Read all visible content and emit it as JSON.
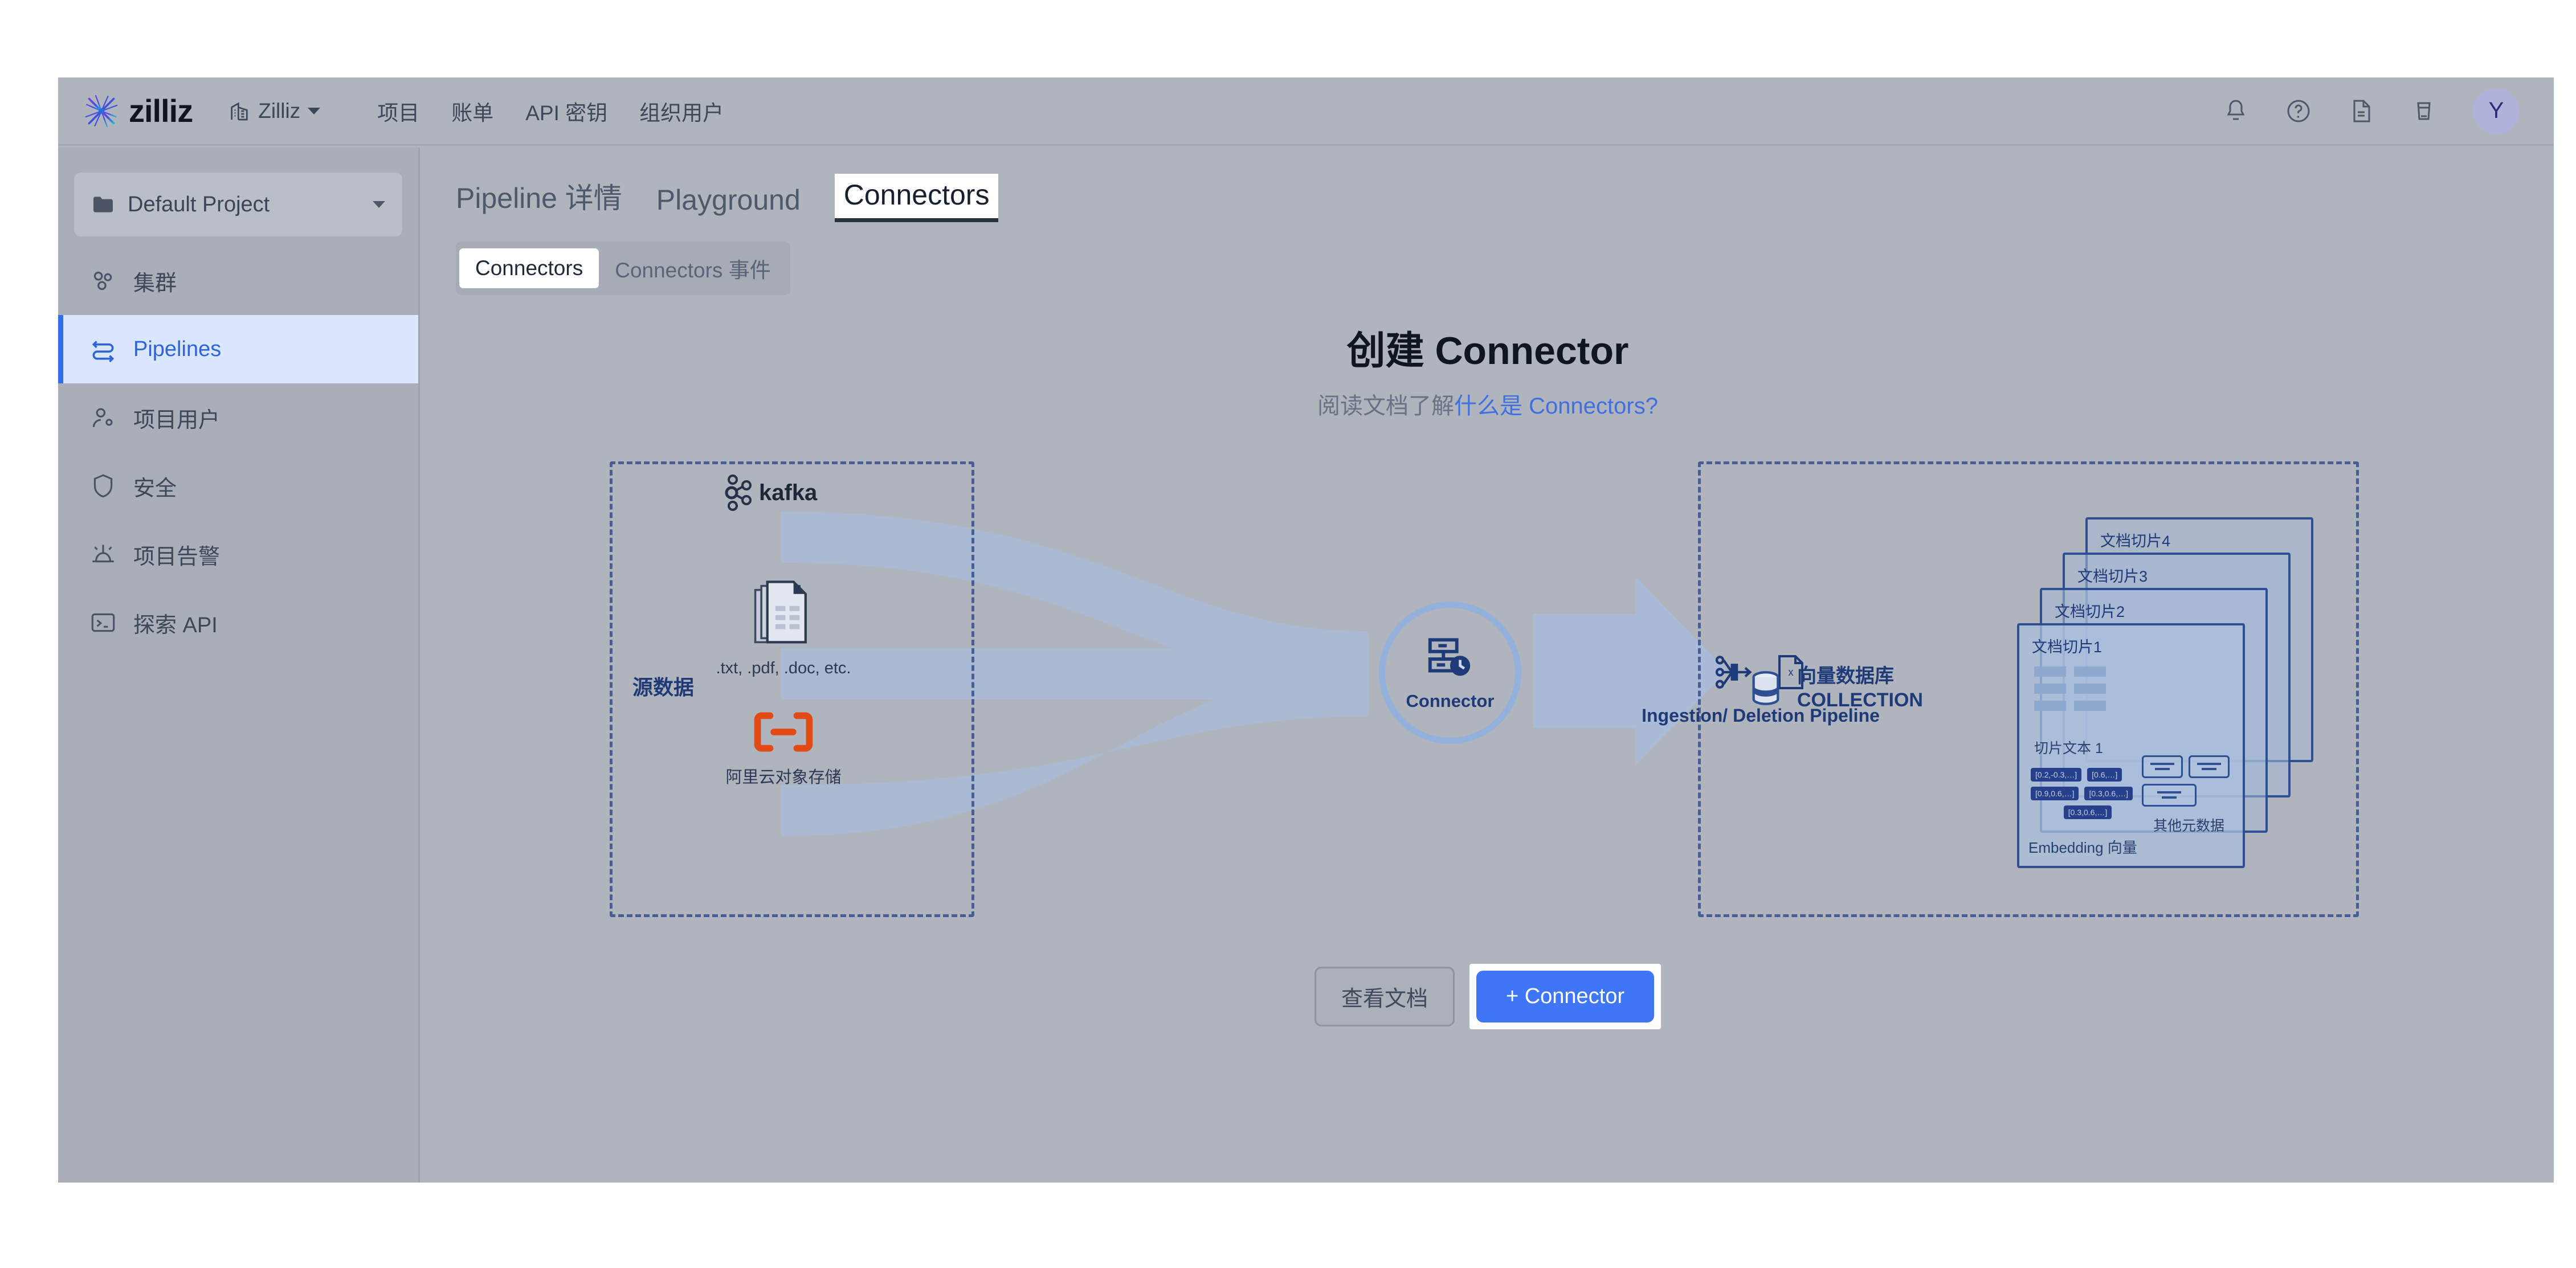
{
  "header": {
    "brand": "zilliz",
    "brand_icon": "starburst-icon",
    "org": {
      "icon": "building-icon",
      "name": "Zilliz",
      "caret": "chevron-down-icon"
    },
    "nav": [
      {
        "label": "项目"
      },
      {
        "label": "账单"
      },
      {
        "label": "API 密钥"
      },
      {
        "label": "组织用户"
      }
    ],
    "actions": [
      {
        "icon": "bell-icon"
      },
      {
        "icon": "help-circle-icon"
      },
      {
        "icon": "document-icon"
      },
      {
        "icon": "cup-icon"
      }
    ],
    "avatar": {
      "initial": "Y",
      "bg": "#b0b2d8"
    }
  },
  "sidebar": {
    "project": {
      "icon": "folder-icon",
      "name": "Default Project",
      "caret": "chevron-down-icon"
    },
    "items": [
      {
        "icon": "cluster-icon",
        "label": "集群",
        "active": false
      },
      {
        "icon": "pipeline-icon",
        "label": "Pipelines",
        "active": true
      },
      {
        "icon": "users-icon",
        "label": "项目用户",
        "active": false
      },
      {
        "icon": "shield-icon",
        "label": "安全",
        "active": false
      },
      {
        "icon": "alarm-icon",
        "label": "项目告警",
        "active": false
      },
      {
        "icon": "terminal-icon",
        "label": "探索 API",
        "active": false
      }
    ],
    "active_bg": "#D9E6FB",
    "active_color": "#2F64DB"
  },
  "main": {
    "tabs": [
      {
        "label": "Pipeline 详情",
        "active": false
      },
      {
        "label": "Playground",
        "active": false
      },
      {
        "label": "Connectors",
        "active": true
      }
    ],
    "subtabs": [
      {
        "label": "Connectors",
        "active": true
      },
      {
        "label": "Connectors 事件",
        "active": false
      }
    ],
    "hero": {
      "title": "创建 Connector",
      "subtitle_prefix": "阅读文档了解",
      "subtitle_link": "什么是 Connectors?",
      "link_color": "#3f6fe0"
    },
    "diagram": {
      "source": {
        "label": "源数据",
        "items": [
          {
            "icon": "kafka-logo",
            "caption": "kafka"
          },
          {
            "icon": "documents-icon",
            "caption": ".txt, .pdf, .doc, etc."
          },
          {
            "icon": "alibaba-oss-logo",
            "caption": "阿里云对象存储"
          }
        ]
      },
      "connector": {
        "icon": "server-clock-icon",
        "label": "Connector"
      },
      "pipeline": {
        "icons": [
          "pipeline-split-icon",
          "file-x-icon"
        ],
        "label": "Ingestion/ Deletion Pipeline"
      },
      "destination": {
        "icon": "database-icon",
        "label_line1": "向量数据库",
        "label_line2": "COLLECTION",
        "cards": [
          {
            "title": "文档切片4"
          },
          {
            "title": "文档切片3"
          },
          {
            "title": "文档切片2"
          },
          {
            "title": "文档切片1"
          }
        ],
        "front_card": {
          "chunk_text_caption": "切片文本 1",
          "embedding_caption": "Embedding 向量",
          "metadata_caption": "其他元数据",
          "vector_chips": [
            "[0.2,-0.3,…]",
            "[0.6,…]",
            "[0.9,0.6,…]",
            "[0.3,0.6,…]",
            "[0.3,0.6,…]"
          ]
        }
      }
    },
    "footer": {
      "docs_button": "查看文档",
      "add_button": "+ Connector",
      "add_button_color": "#3E76F5"
    }
  }
}
